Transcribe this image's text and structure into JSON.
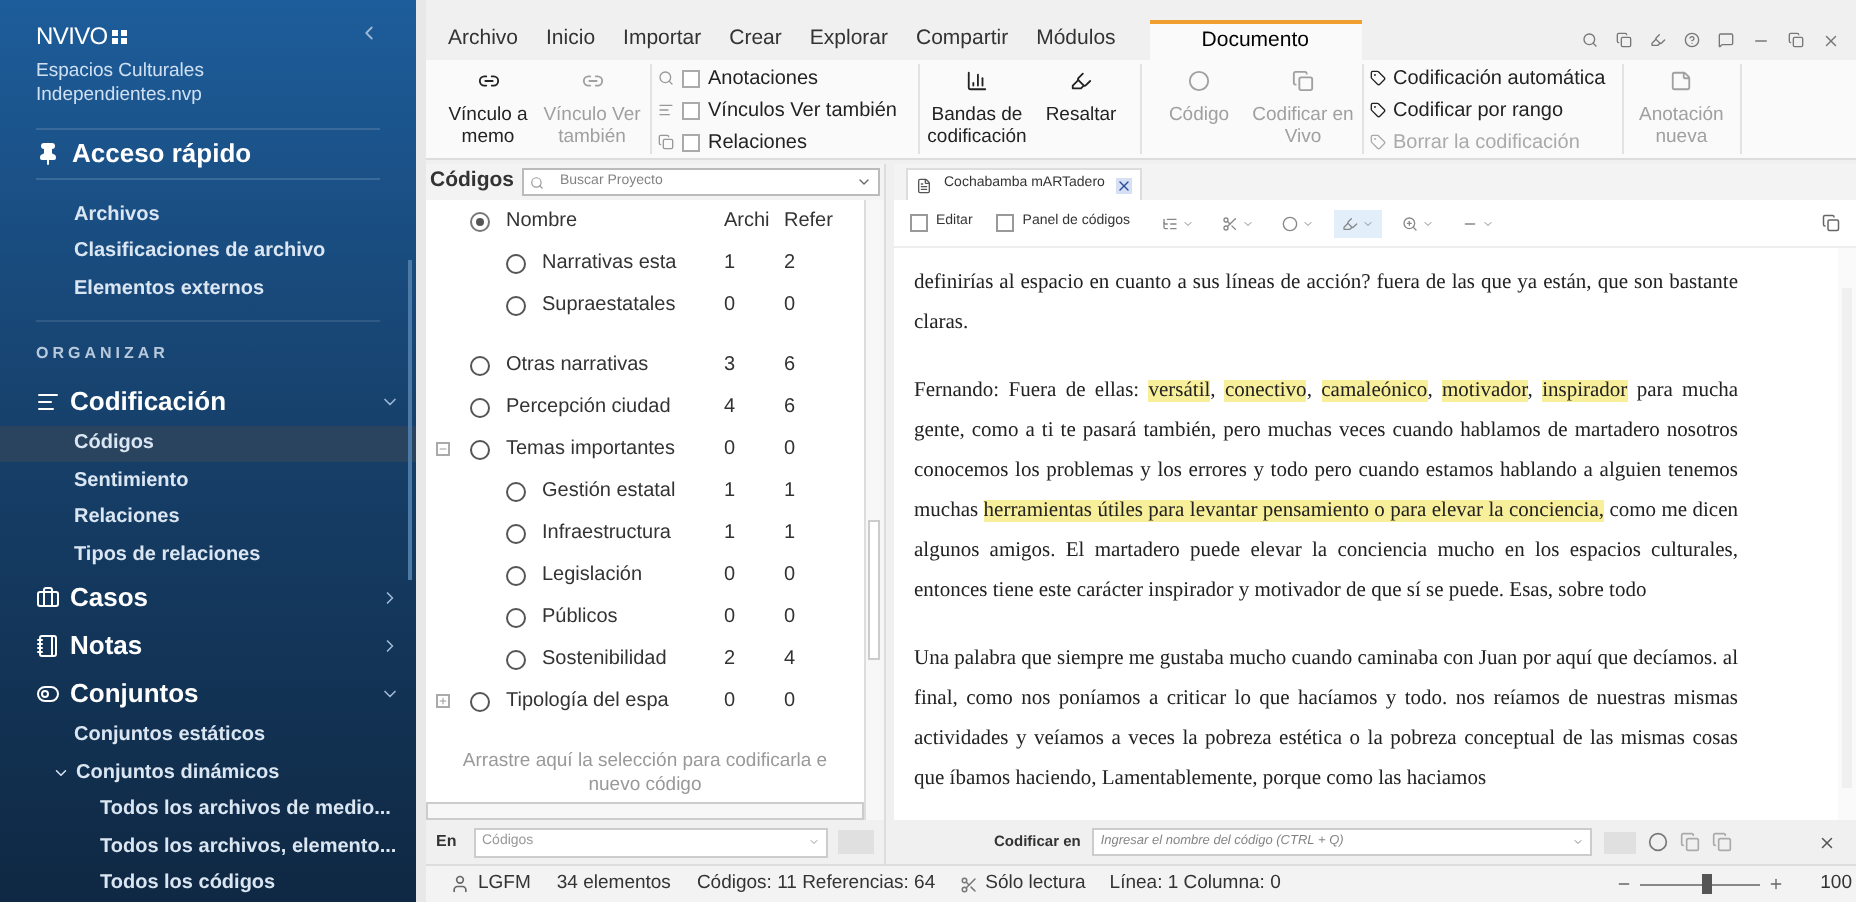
{
  "sidebar": {
    "logo": "NVIVO",
    "project": "Espacios Culturales Independientes.nvp",
    "quick_access": {
      "label": "Acceso rápido",
      "items": [
        {
          "label": "Archivos",
          "selected": false
        },
        {
          "label": "Clasificaciones de archivo",
          "selected": false
        },
        {
          "label": "Elementos externos",
          "selected": false
        }
      ]
    },
    "section_label": "ORGANIZAR",
    "groups": [
      {
        "label": "Codificación",
        "expanded": true,
        "items": [
          {
            "label": "Códigos",
            "selected": true
          },
          {
            "label": "Sentimiento",
            "selected": false
          },
          {
            "label": "Relaciones",
            "selected": false
          },
          {
            "label": "Tipos de relaciones",
            "selected": false
          }
        ]
      },
      {
        "label": "Casos",
        "expanded": false
      },
      {
        "label": "Notas",
        "expanded": false
      },
      {
        "label": "Conjuntos",
        "expanded": true,
        "items": [
          {
            "label": "Conjuntos estáticos",
            "selected": false
          },
          {
            "label": "Conjuntos dinámicos",
            "selected": false,
            "expanded": true,
            "children": [
              {
                "label": "Todos los archivos de medio...",
                "selected": false
              },
              {
                "label": "Todos los archivos, elemento...",
                "selected": false
              },
              {
                "label": "Todos los códigos",
                "selected": false
              }
            ]
          }
        ]
      }
    ]
  },
  "ribbon": {
    "tabs": [
      {
        "label": "Archivo",
        "selected": false
      },
      {
        "label": "Inicio",
        "selected": false
      },
      {
        "label": "Importar",
        "selected": false
      },
      {
        "label": "Crear",
        "selected": false
      },
      {
        "label": "Explorar",
        "selected": false
      },
      {
        "label": "Compartir",
        "selected": false
      },
      {
        "label": "Módulos",
        "selected": false
      },
      {
        "label": "Documento",
        "selected": true
      }
    ],
    "groups": [
      {
        "kind": "large",
        "buttons": [
          {
            "label": "Vínculo a memo",
            "disabled": false
          },
          {
            "label": "Vínculo Ver también",
            "disabled": true
          }
        ]
      },
      {
        "kind": "checks",
        "items": [
          {
            "label": "Anotaciones",
            "checked": false
          },
          {
            "label": "Vínculos Ver también",
            "checked": false
          },
          {
            "label": "Relaciones",
            "checked": false
          }
        ]
      },
      {
        "kind": "large",
        "buttons": [
          {
            "label": "Bandas de codificación",
            "disabled": false
          },
          {
            "label": "Resaltar",
            "disabled": false
          }
        ]
      },
      {
        "kind": "large",
        "buttons": [
          {
            "label": "Código",
            "disabled": true
          },
          {
            "label": "Codificar en Vivo",
            "disabled": true
          }
        ]
      },
      {
        "kind": "small",
        "items": [
          {
            "label": "Codificación automática",
            "disabled": false
          },
          {
            "label": "Codificar por rango",
            "disabled": false
          },
          {
            "label": "Borrar la codificación",
            "disabled": true
          }
        ]
      },
      {
        "kind": "large",
        "buttons": [
          {
            "label": "Anotación nueva",
            "disabled": true
          }
        ]
      }
    ]
  },
  "codes_panel": {
    "title": "Códigos",
    "search": {
      "placeholder": "Buscar Proyecto"
    },
    "columns": [
      "Nombre",
      "Archi",
      "Refer"
    ],
    "header_radio": {
      "selected": true
    },
    "rows": [
      {
        "children": [
          {
            "name": "Narrativas esta",
            "files": "1",
            "refs": "2"
          },
          {
            "name": "Supraestatales",
            "files": "0",
            "refs": "0"
          }
        ]
      },
      {
        "name": "Otras narrativas",
        "files": "3",
        "refs": "6"
      },
      {
        "name": "Percepción ciudad",
        "files": "4",
        "refs": "6"
      },
      {
        "name": "Temas importantes",
        "files": "0",
        "refs": "0",
        "expanded": true,
        "children": [
          {
            "name": "Gestión estatal",
            "files": "1",
            "refs": "1"
          },
          {
            "name": "Infraestructura",
            "files": "1",
            "refs": "1"
          },
          {
            "name": "Legislación",
            "files": "0",
            "refs": "0"
          },
          {
            "name": "Públicos",
            "files": "0",
            "refs": "0"
          },
          {
            "name": "Sostenibilidad",
            "files": "2",
            "refs": "4"
          }
        ]
      },
      {
        "name": "Tipología del espa",
        "files": "0",
        "refs": "0",
        "expanded": false
      }
    ],
    "drop_hint": [
      "Arrastre aquí la selección para codificarla e",
      "nuevo código"
    ],
    "scope": {
      "label": "En",
      "value": "Códigos"
    }
  },
  "document": {
    "tab": "Cochabamba mARTadero",
    "toolbar": [
      {
        "label": "Editar",
        "checked": false
      },
      {
        "label": "Panel de códigos",
        "checked": false
      }
    ],
    "paragraphs": [
      [
        {
          "text": "definirías al espacio en cuanto a sus líneas de acción? fuera de las que ya están, que son bastante claras.",
          "highlighted": false
        }
      ],
      [
        {
          "text": "Fernando: Fuera de ellas: ",
          "highlighted": false
        },
        {
          "text": "versátil",
          "highlighted": true
        },
        {
          "text": ", ",
          "highlighted": false
        },
        {
          "text": "conectivo",
          "highlighted": true
        },
        {
          "text": ", ",
          "highlighted": false
        },
        {
          "text": "camaleónico",
          "highlighted": true
        },
        {
          "text": ", ",
          "highlighted": false
        },
        {
          "text": "motivador",
          "highlighted": true
        },
        {
          "text": ", ",
          "highlighted": false
        },
        {
          "text": "inspirador",
          "highlighted": true
        },
        {
          "text": " para mucha gente, como a ti te pasará también, pero muchas veces cuando hablamos de martadero nosotros conocemos los problemas y los errores y todo pero cuando estamos hablando a alguien tenemos muchas ",
          "highlighted": false
        },
        {
          "text": "herramientas útiles para levantar pensamiento o para elevar la conciencia,",
          "highlighted": true
        },
        {
          "text": " como me dicen algunos amigos. El martadero puede elevar la conciencia mucho en los espacios culturales, entonces tiene este carácter inspirador y motivador de que sí se puede. Esas, sobre todo",
          "highlighted": false
        }
      ],
      [
        {
          "text": "Una palabra que siempre me gustaba mucho cuando caminaba con Juan por aquí que decíamos. al final, como nos poníamos a criticar lo que hacíamos y todo. nos reíamos de nuestras mismas actividades y veíamos a veces la pobreza estética o la pobreza conceptual de las mismas cosas que íbamos haciendo, Lamentablemente, porque como las haciamos",
          "highlighted": false
        }
      ]
    ],
    "code_in": {
      "label": "Codificar en",
      "placeholder": "Ingresar el nombre del código (CTRL + Q)"
    }
  },
  "status_bar": {
    "user": "LGFM",
    "items": "34 elementos",
    "counts": "Códigos: 11 Referencias: 64",
    "mode": "Sólo lectura",
    "position": "Línea: 1 Columna: 0",
    "zoom": {
      "level": 0.55
    },
    "zoom_reading": "100"
  }
}
